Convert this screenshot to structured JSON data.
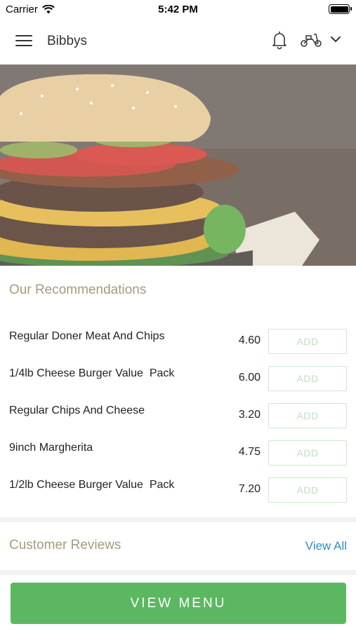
{
  "status_bar": {
    "carrier": "Carrier",
    "time": "5:42 PM"
  },
  "header": {
    "title": "Bibbys",
    "icons": [
      "menu-icon",
      "bell-icon",
      "scooter-icon",
      "chevron-down-icon"
    ]
  },
  "hero": {
    "image": "burger-photo"
  },
  "recommendations": {
    "title": "Our Recommendations",
    "add_label": "ADD",
    "items": [
      {
        "name": "Regular Doner Meat And Chips",
        "price": "4.60"
      },
      {
        "name": "1/4lb Cheese Burger Value  Pack",
        "price": "6.00"
      },
      {
        "name": "Regular Chips And Cheese",
        "price": "3.20"
      },
      {
        "name": "9inch Margherita",
        "price": "4.75"
      },
      {
        "name": "1/2lb Cheese Burger Value  Pack",
        "price": "7.20"
      }
    ]
  },
  "reviews": {
    "title": "Customer Reviews",
    "view_all": "View All"
  },
  "footer": {
    "view_menu_label": "VIEW MENU"
  },
  "colors": {
    "accent_green": "#5cb860",
    "section_title": "#a79b7f",
    "link_blue": "#2f8fbf",
    "add_border": "#cfe8cf"
  }
}
